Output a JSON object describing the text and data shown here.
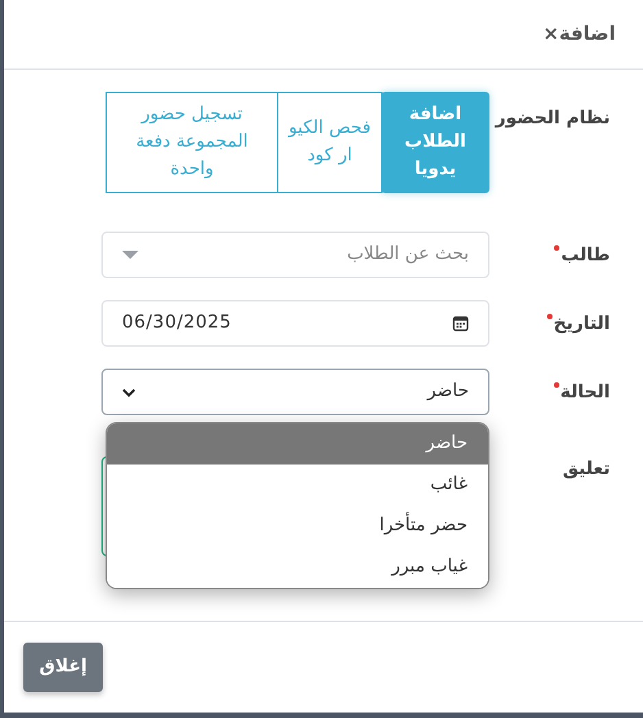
{
  "dialog": {
    "title": "اضافة",
    "close": "×"
  },
  "attendance_mode": {
    "label": "نظام الحضور",
    "options": [
      {
        "label": "اضافة الطلاب يدويا",
        "selected": true
      },
      {
        "label": "فحص الكيو ار كود",
        "selected": false
      },
      {
        "label": "تسجيل حضور المجموعة دفعة واحدة",
        "selected": false
      }
    ]
  },
  "fields": [
    {
      "kind": "search-select",
      "label": "طالب",
      "required": true,
      "placeholder": "بحث عن الطلاب"
    },
    {
      "kind": "date",
      "label": "التاريخ",
      "required": true,
      "value": "06/30/2025"
    },
    {
      "kind": "select",
      "label": "الحالة",
      "required": true,
      "value": "حاضر",
      "expanded": true,
      "options": [
        {
          "label": "حاضر",
          "selected": true
        },
        {
          "label": "غائب",
          "selected": false
        },
        {
          "label": "حضر متأخرا",
          "selected": false
        },
        {
          "label": "غياب مبرر",
          "selected": false
        }
      ]
    },
    {
      "kind": "textarea",
      "label": "تعليق",
      "focused": true
    }
  ],
  "footer": {
    "close_button": "إغلاق"
  }
}
